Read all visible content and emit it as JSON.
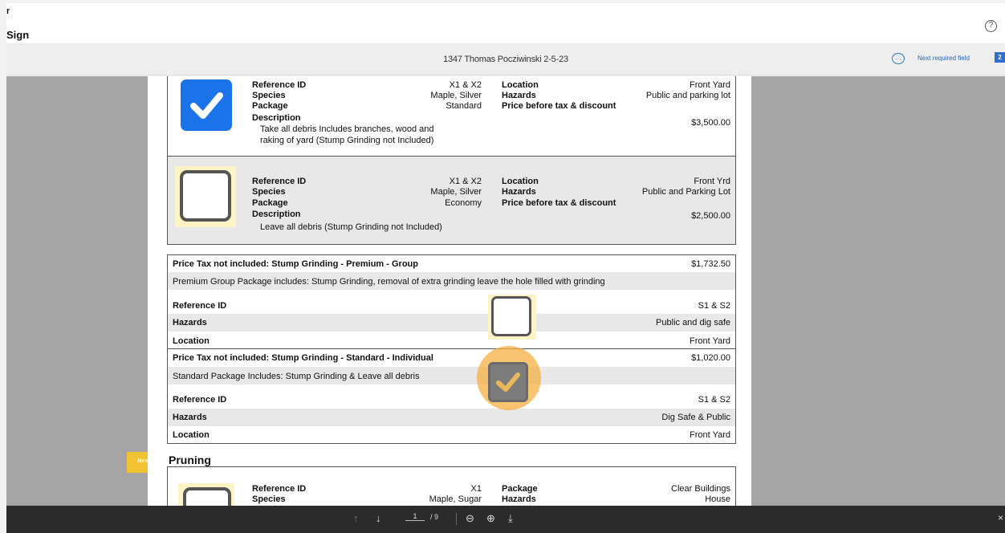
{
  "header": {
    "caret": "r",
    "title": "Sign",
    "help_icon": "help-icon"
  },
  "docbar": {
    "document_name": "1347 Thomas Pocziwinski 2-5-23",
    "comment_icon": "comment-icon",
    "next_required_label": "Next required field",
    "counter": "2"
  },
  "next_badge": "Next",
  "options": [
    {
      "checked": true,
      "ref_label": "Reference ID",
      "ref": "X1 & X2",
      "species_label": "Species",
      "species": "Maple, Silver",
      "package_label": "Package",
      "package": "Standard",
      "description_label": "Description",
      "description_1": "Take all debris Includes branches, wood and",
      "description_2": "raking of yard (Stump Grinding not Included)",
      "location_label": "Location",
      "location": "Front Yard",
      "hazards_label": "Hazards",
      "hazards": "Public and parking lot",
      "price_label": "Price before tax & discount",
      "price": "$3,500.00"
    },
    {
      "checked": false,
      "ref_label": "Reference ID",
      "ref": "X1 & X2",
      "species_label": "Species",
      "species": "Maple, Silver",
      "package_label": "Package",
      "package": "Economy",
      "description_label": "Description",
      "description_1": "Leave all debris (Stump Grinding not Included)",
      "location_label": "Location",
      "location": "Front Yrd",
      "hazards_label": "Hazards",
      "hazards": "Public and Parking Lot",
      "price_label": "Price before tax & discount",
      "price": "$2,500.00"
    }
  ],
  "stump_premium": {
    "title": "Price Tax not included: Stump Grinding - Premium - Group",
    "price": "$1,732.50",
    "description": "Premium Group Package includes: Stump Grinding, removal of extra grinding leave the hole filled with grinding",
    "rows": [
      {
        "label": "Reference ID",
        "value": "S1 & S2"
      },
      {
        "label": "Hazards",
        "value": "Public and dig safe"
      },
      {
        "label": "Location",
        "value": "Front Yard"
      }
    ]
  },
  "stump_standard": {
    "title": "Price Tax not included: Stump Grinding - Standard - Individual",
    "price": "$1,020.00",
    "description": "Standard Package Includes: Stump Grinding & Leave all debris",
    "rows": [
      {
        "label": "Reference ID",
        "value": "S1 & S2"
      },
      {
        "label": "Hazards",
        "value": "Dig Safe & Public"
      },
      {
        "label": "Location",
        "value": "Front Yard"
      }
    ]
  },
  "pruning": {
    "heading": "Pruning",
    "ref_label": "Reference ID",
    "ref": "X1",
    "species_label": "Species",
    "species": "Maple, Sugar",
    "package_label": "Package",
    "package": "Clear Buildings",
    "hazards_label": "Hazards",
    "hazards": "House"
  },
  "toolbar": {
    "page": "1",
    "of": "/ 9",
    "up_icon": "arrow-up-icon",
    "down_icon": "arrow-down-icon",
    "zoom_out_icon": "zoom-out-icon",
    "zoom_in_icon": "zoom-in-icon",
    "download_icon": "download-icon",
    "close_icon": "close-icon"
  },
  "colors": {
    "accent": "#1a73e8",
    "highlight": "#fdf3c4",
    "next_badge": "#f1c232",
    "focus_ring": "#f5b041",
    "viewer_bg": "#a5a5a5",
    "toolbar_bg": "#2b2b2b"
  }
}
